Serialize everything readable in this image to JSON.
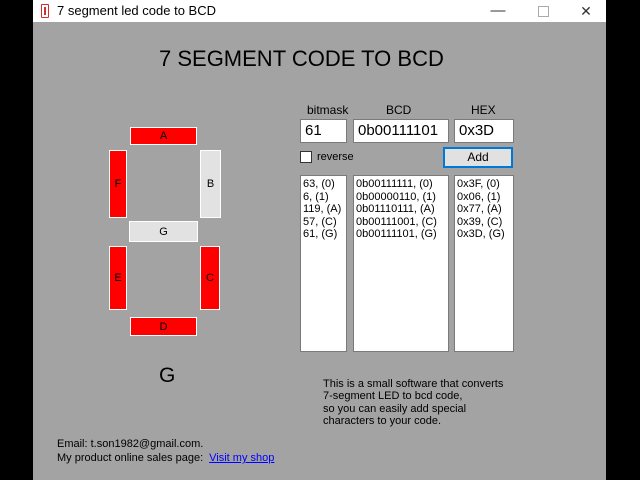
{
  "window": {
    "title": "7 segment led code to BCD",
    "minimize_glyph": "—",
    "close_glyph": "✕"
  },
  "heading": "7 SEGMENT CODE TO BCD",
  "segments": [
    {
      "id": "a",
      "label": "A",
      "on": true
    },
    {
      "id": "b",
      "label": "B",
      "on": false
    },
    {
      "id": "c",
      "label": "C",
      "on": true
    },
    {
      "id": "d",
      "label": "D",
      "on": true
    },
    {
      "id": "e",
      "label": "E",
      "on": true
    },
    {
      "id": "f",
      "label": "F",
      "on": true
    },
    {
      "id": "g",
      "label": "G",
      "on": false
    }
  ],
  "char_display": "G",
  "columns": {
    "bitmask_label": "bitmask",
    "bcd_label": "BCD",
    "hex_label": "HEX"
  },
  "inputs": {
    "bitmask": "61",
    "bcd": "0b00111101",
    "hex": "0x3D"
  },
  "reverse_label": "reverse",
  "reverse_checked": false,
  "add_label": "Add",
  "lists": {
    "bitmask": [
      "63, (0)",
      "6, (1)",
      "119, (A)",
      "57, (C)",
      "61, (G)"
    ],
    "bcd": [
      "0b00111111, (0)",
      "0b00000110, (1)",
      "0b01110111, (A)",
      "0b00111001, (C)",
      "0b00111101, (G)"
    ],
    "hex": [
      "0x3F, (0)",
      "0x06, (1)",
      "0x77, (A)",
      "0x39, (C)",
      "0x3D, (G)"
    ]
  },
  "description": [
    "This is a small software that converts",
    "7-segment LED to bcd code,",
    "so you can easily add special",
    "characters to your code."
  ],
  "footer": {
    "email": "Email: t.son1982@gmail.com.",
    "shop_label": "My product online sales page:",
    "shop_link": "Visit my shop"
  },
  "colors": {
    "segment_on": "#ff0000",
    "segment_off": "#e2e2e2",
    "window_bg": "#a3a3a3",
    "link": "#0000ff"
  }
}
